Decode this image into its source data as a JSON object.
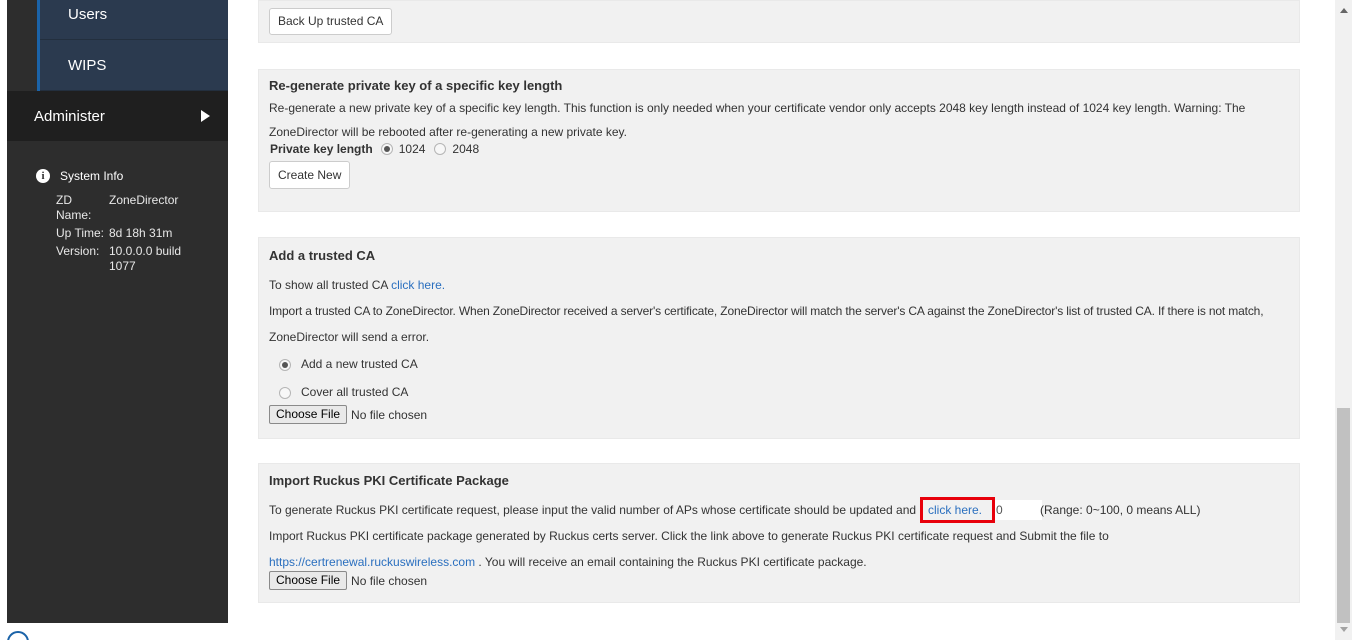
{
  "sidebar": {
    "sub_items": [
      {
        "label": "Users"
      },
      {
        "label": "WIPS"
      }
    ],
    "administer": {
      "label": "Administer"
    },
    "system_info": {
      "title": "System Info",
      "rows": [
        {
          "key": "ZD Name:",
          "value": "ZoneDirector"
        },
        {
          "key": "Up Time:",
          "value": "8d 18h 31m"
        },
        {
          "key": "Version:",
          "value": "10.0.0.0 build 1077"
        }
      ]
    }
  },
  "backup": {
    "button_label": "Back Up trusted CA"
  },
  "regen": {
    "title": "Re-generate private key of a specific key length",
    "desc_line1": "Re-generate a new private key of a specific key length. This function is only needed when your certificate vendor only accepts 2048 key length instead of 1024 key length. Warning: The",
    "desc_line2": "ZoneDirector will be rebooted after re-generating a new private key.",
    "key_length_label": "Private key length",
    "options": [
      {
        "label": "1024",
        "checked": true
      },
      {
        "label": "2048",
        "checked": false
      }
    ],
    "create_button": "Create New"
  },
  "trusted_ca": {
    "title": "Add a trusted CA",
    "show_prefix": "To show all trusted CA ",
    "show_link": "click here.",
    "desc_line1": "Import a trusted CA to ZoneDirector. When ZoneDirector received a server's certificate, ZoneDirector will match the server's CA against the ZoneDirector's list of trusted CA. If there is not match,",
    "desc_line2": "ZoneDirector will send a error.",
    "options": [
      {
        "label": "Add a new trusted CA",
        "checked": true
      },
      {
        "label": "Cover all trusted CA",
        "checked": false
      }
    ],
    "choose_file": "Choose File",
    "file_status": "No file chosen"
  },
  "pki": {
    "title": "Import Ruckus PKI Certificate Package",
    "generate_prefix": "To generate Ruckus PKI certificate request, please input the valid number of APs whose certificate should be updated and",
    "generate_link": "click here.",
    "ap_count_value": "0",
    "range_text": "(Range: 0~100, 0 means ALL)",
    "desc_line1": "Import Ruckus PKI certificate package generated by Ruckus certs server. Click the link above to generate Ruckus PKI certificate request and Submit the file to",
    "server_link": "https://certrenewal.ruckuswireless.com",
    "desc_line2_suffix": " . You will receive an email containing the Ruckus PKI certificate package.",
    "choose_file": "Choose File",
    "file_status": "No file chosen"
  },
  "colors": {
    "sidebar_bg": "#2d2d2d",
    "accent": "#1b63a8",
    "link": "#2a6fbf",
    "highlight_box": "#e8000b"
  }
}
